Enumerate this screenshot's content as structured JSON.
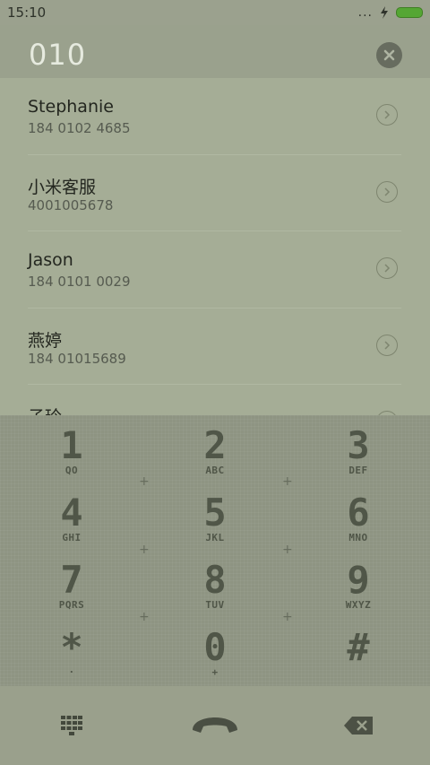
{
  "status_bar": {
    "time": "15:10",
    "dots": "..."
  },
  "search": {
    "number": "010"
  },
  "contacts": [
    {
      "name": "Stephanie",
      "number": "184 0102 4685"
    },
    {
      "name": "小米客服",
      "number": "4001005678"
    },
    {
      "name": "Jason",
      "number": "184 0101 0029"
    },
    {
      "name": "燕婷",
      "number": "184 01015689"
    },
    {
      "name": "子玲",
      "number": ""
    }
  ],
  "keypad": [
    {
      "digit": "1",
      "letters": "QO"
    },
    {
      "digit": "2",
      "letters": "ABC"
    },
    {
      "digit": "3",
      "letters": "DEF"
    },
    {
      "digit": "4",
      "letters": "GHI"
    },
    {
      "digit": "5",
      "letters": "JKL"
    },
    {
      "digit": "6",
      "letters": "MNO"
    },
    {
      "digit": "7",
      "letters": "PQRS"
    },
    {
      "digit": "8",
      "letters": "TUV"
    },
    {
      "digit": "9",
      "letters": "WXYZ"
    },
    {
      "digit": "*",
      "letters": "·"
    },
    {
      "digit": "0",
      "letters": "+"
    },
    {
      "digit": "#",
      "letters": ""
    }
  ],
  "colors": {
    "accent_battery": "#55a634",
    "screen_tint": "#a7ae98"
  },
  "icons": [
    "bolt-icon",
    "battery-icon",
    "clear-icon",
    "chevron-right-icon",
    "dialpad-grid-icon",
    "call-icon",
    "backspace-icon"
  ]
}
